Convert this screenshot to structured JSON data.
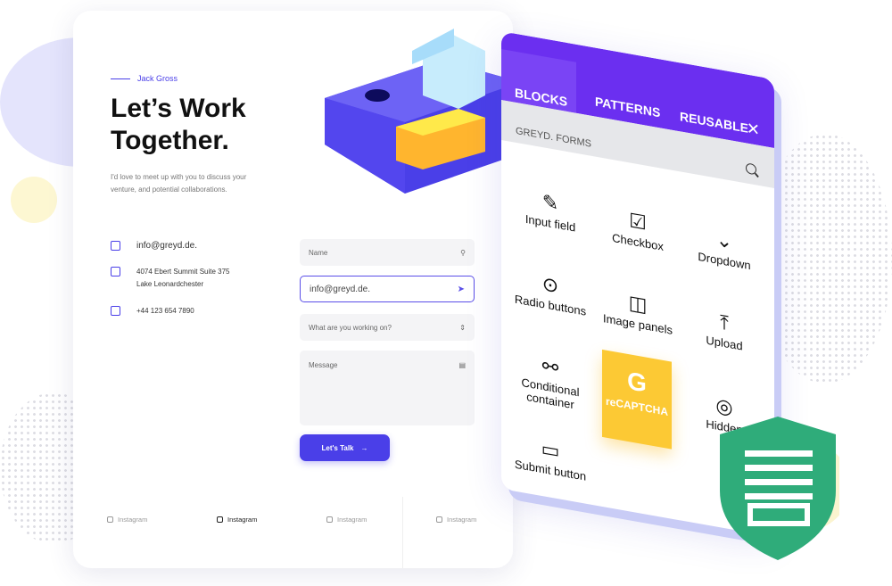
{
  "contact_card": {
    "author": "Jack Gross",
    "title_line1": "Let’s Work",
    "title_line2": "Together.",
    "description": "I'd love to meet up with you to discuss your venture, and potential collaborations.",
    "email": "info@greyd.de.",
    "address_line1": "4074 Ebert Summit Suite 375",
    "address_line2": "Lake Leonardchester",
    "phone": "+44 123 654 7890",
    "form": {
      "name_placeholder": "Name",
      "email_value": "info@greyd.de.",
      "project_placeholder": "What are you working on?",
      "message_placeholder": "Message",
      "submit_label": "Let's Talk"
    },
    "footer_links": [
      "Instagram",
      "Instagram",
      "Instagram",
      "Instagram"
    ]
  },
  "blocks_panel": {
    "tabs": [
      "BLOCKS",
      "PATTERNS",
      "REUSABLE"
    ],
    "active_tab": "BLOCKS",
    "section_label": "GREYD. FORMS",
    "items": [
      "Input field",
      "Checkbox",
      "Dropdown",
      "Radio buttons",
      "Image panels",
      "Upload",
      "Conditional container",
      "reCAPTCHA",
      "Hidden",
      "Submit button"
    ]
  },
  "colors": {
    "accent": "#4a3fe8",
    "panel_header": "#6b2ff0",
    "recaptcha": "#fcc934",
    "shield": "#2fac7a"
  }
}
